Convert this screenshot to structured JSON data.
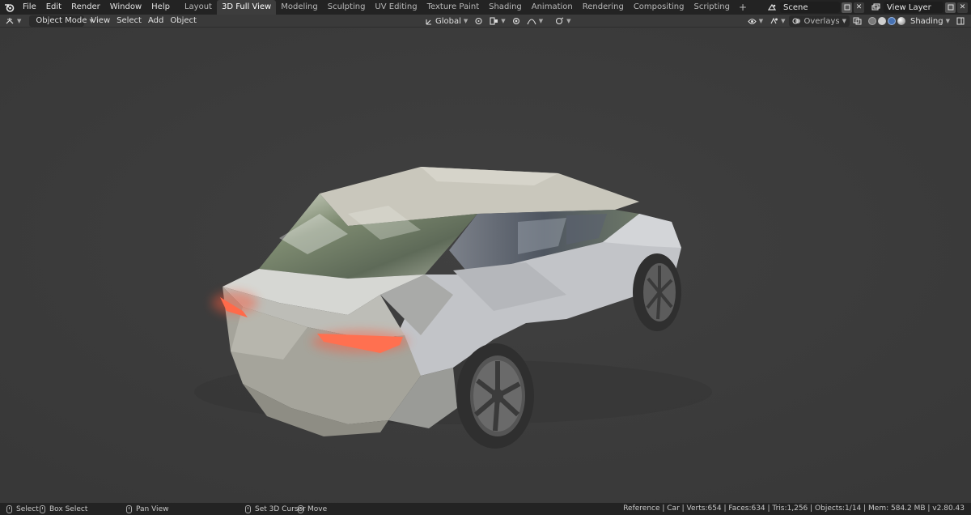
{
  "topbar": {
    "menus": [
      "File",
      "Edit",
      "Render",
      "Window",
      "Help"
    ],
    "workspaces": [
      "Layout",
      "3D Full View",
      "Modeling",
      "Sculpting",
      "UV Editing",
      "Texture Paint",
      "Shading",
      "Animation",
      "Rendering",
      "Compositing",
      "Scripting"
    ],
    "active_workspace": "3D Full View",
    "add_tab": "+",
    "scene_name": "Scene",
    "view_layer_name": "View Layer"
  },
  "header": {
    "mode": "Object Mode",
    "menus": [
      "View",
      "Select",
      "Add",
      "Object"
    ],
    "transform_orientation": "Global",
    "overlays_label": "Overlays",
    "shading_label": "Shading"
  },
  "statusbar": {
    "select": "Select",
    "box_select": "Box Select",
    "pan_view": "Pan View",
    "set_cursor": "Set 3D Cursor",
    "move": "Move",
    "stats": "Reference | Car | Verts:654 | Faces:634 | Tris:1,256 | Objects:1/14 | Mem: 584.2 MB | v2.80.43"
  },
  "colors": {
    "accent": "#4772b3",
    "taillight": "#ff5a3c"
  }
}
